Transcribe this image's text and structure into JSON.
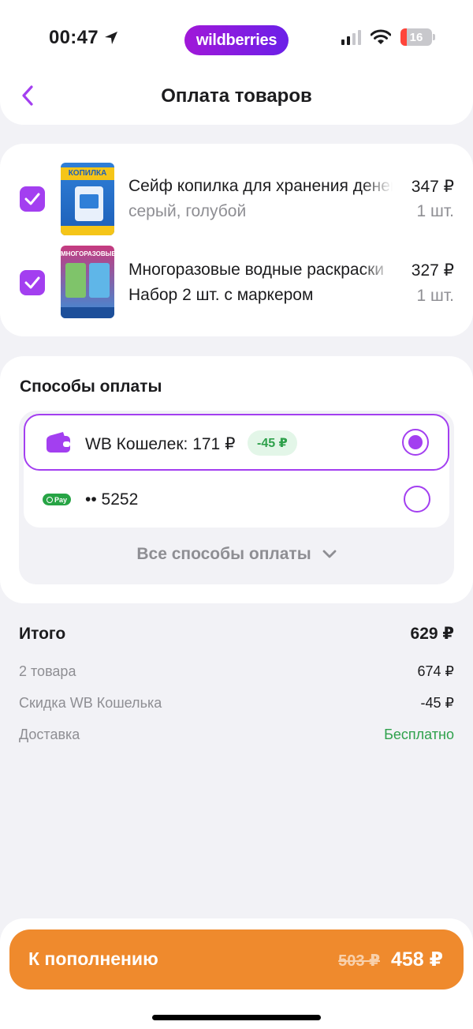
{
  "status_bar": {
    "time": "00:47",
    "battery": "16"
  },
  "brand": "wildberries",
  "header": {
    "title": "Оплата товаров"
  },
  "products": [
    {
      "name": "Сейф копилка для хранения денег",
      "variant": "серый, голубой",
      "price": "347 ₽",
      "qty": "1 шт.",
      "thumb_text": "КОПИЛКА"
    },
    {
      "name": "Многоразовые водные раскраски Набор 2 шт. с маркером",
      "variant": "",
      "price": "327 ₽",
      "qty": "1 шт.",
      "thumb_text": "МНОГОРАЗОВЫЕ"
    }
  ],
  "payment": {
    "title": "Способы оплаты",
    "options": [
      {
        "label": "WB Кошелек: 171 ₽",
        "badge": "-45 ₽",
        "selected": true,
        "icon": "wallet-icon"
      },
      {
        "label": "•• 5252",
        "selected": false,
        "icon": "gpay-icon",
        "icon_text": "Pay"
      }
    ],
    "all_methods": "Все способы оплаты"
  },
  "summary": {
    "total_label": "Итого",
    "total_value": "629 ₽",
    "rows": [
      {
        "label": "2 товара",
        "value": "674 ₽"
      },
      {
        "label": "Скидка WB Кошелька",
        "value": "-45 ₽"
      },
      {
        "label": "Доставка",
        "value": "Бесплатно"
      }
    ]
  },
  "pay_button": {
    "label": "К пополнению",
    "old_price": "503 ₽",
    "new_price": "458 ₽"
  },
  "colors": {
    "accent": "#a33ff0",
    "pay_button": "#ef8a2d",
    "discount_green": "#2fa14c"
  }
}
